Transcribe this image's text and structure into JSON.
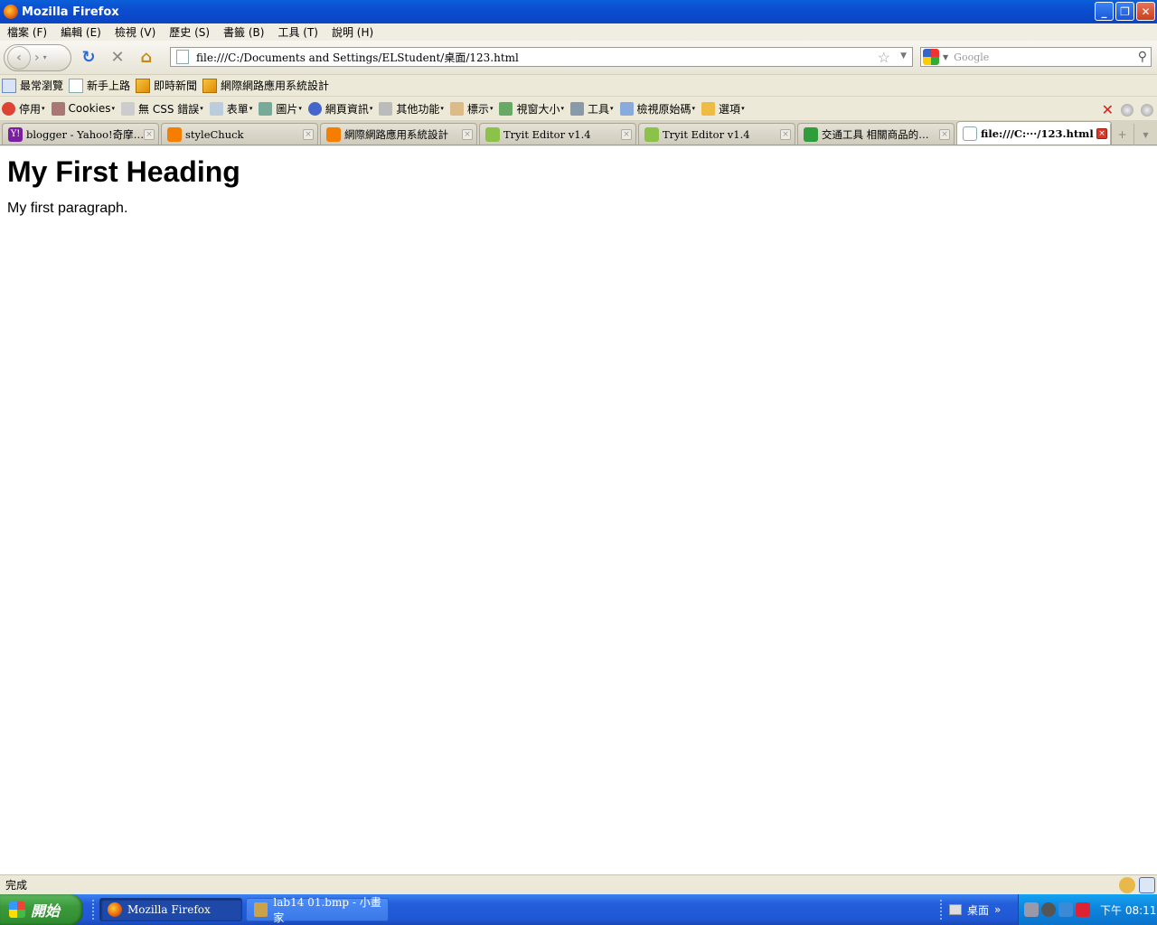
{
  "window": {
    "title": "Mozilla Firefox"
  },
  "menu": [
    "檔案 (F)",
    "編輯 (E)",
    "檢視 (V)",
    "歷史 (S)",
    "書籤 (B)",
    "工具 (T)",
    "說明 (H)"
  ],
  "nav": {
    "url": "file:///C:/Documents and Settings/ELStudent/桌面/123.html",
    "search_placeholder": "Google"
  },
  "bookmarks": [
    "最常瀏覽",
    "新手上路",
    "即時新聞",
    "網際網路應用系統設計"
  ],
  "webdev": [
    "停用",
    "Cookies",
    "無 CSS 錯誤",
    "表單",
    "圖片",
    "網頁資訊",
    "其他功能",
    "標示",
    "視窗大小",
    "工具",
    "檢視原始碼",
    "選項"
  ],
  "tabs": [
    {
      "label": "blogger - Yahoo!奇摩…",
      "icon": "yahoo-icon"
    },
    {
      "label": "styleChuck",
      "icon": "blogger-icon"
    },
    {
      "label": "網際網路應用系統設計",
      "icon": "blogger-icon"
    },
    {
      "label": "Tryit Editor v1.4",
      "icon": "w3schools-icon"
    },
    {
      "label": "Tryit Editor v1.4",
      "icon": "w3schools-icon"
    },
    {
      "label": "交通工具 相關商品的…",
      "icon": "site-icon"
    },
    {
      "label": "file:///C:···/123.html",
      "icon": "page-icon",
      "active": true
    }
  ],
  "page": {
    "heading": "My First Heading",
    "paragraph": "My first paragraph."
  },
  "status": {
    "text": "完成"
  },
  "taskbar": {
    "start": "開始",
    "tasks": [
      "Mozilla Firefox",
      "lab14 01.bmp - 小畫家"
    ],
    "desk_label": "桌面",
    "clock": "下午 08:11"
  }
}
